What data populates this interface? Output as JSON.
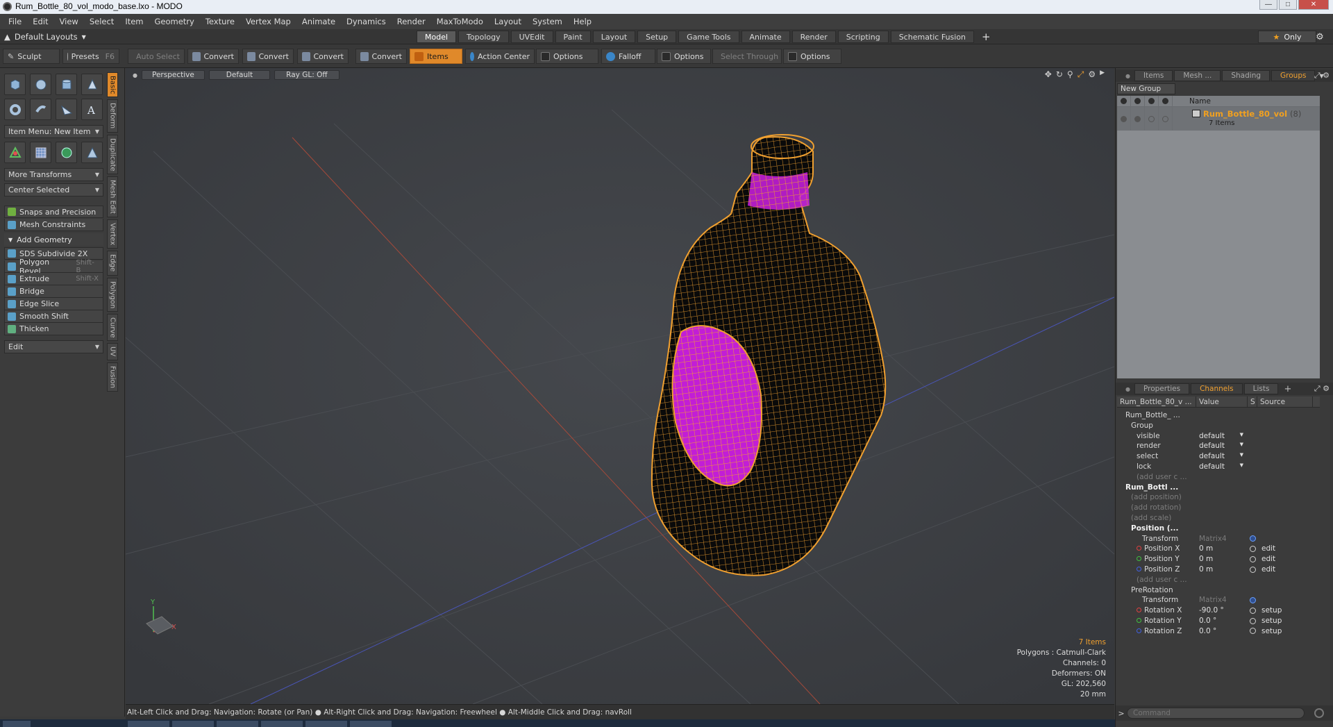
{
  "window": {
    "title": "Rum_Bottle_80_vol_modo_base.lxo - MODO"
  },
  "menubar": [
    "File",
    "Edit",
    "View",
    "Select",
    "Item",
    "Geometry",
    "Texture",
    "Vertex Map",
    "Animate",
    "Dynamics",
    "Render",
    "MaxToModo",
    "Layout",
    "System",
    "Help"
  ],
  "layoutbar": {
    "layout_label": "Default Layouts",
    "tabs": [
      "Model",
      "Topology",
      "UVEdit",
      "Paint",
      "Layout",
      "Setup",
      "Game Tools",
      "Animate",
      "Render",
      "Scripting",
      "Schematic Fusion"
    ],
    "active_tab": "Model",
    "only_label": "Only"
  },
  "toolbar": {
    "sculpt": "Sculpt",
    "presets": "Presets",
    "presets_key": "F6",
    "auto_select": "Auto Select",
    "convert": "Convert",
    "items": "Items",
    "action_center": "Action Center",
    "options": "Options",
    "falloff": "Falloff",
    "select_through": "Select Through"
  },
  "leftpanel": {
    "item_menu": "Item Menu: New Item",
    "more_transforms": "More Transforms",
    "center_selected": "Center Selected",
    "snaps": "Snaps and Precision",
    "mesh_constraints": "Mesh Constraints",
    "add_geometry": "Add Geometry",
    "tools": [
      {
        "label": "SDS Subdivide 2X",
        "key": ""
      },
      {
        "label": "Polygon Bevel",
        "key": "Shift-B"
      },
      {
        "label": "Extrude",
        "key": "Shift-X"
      },
      {
        "label": "Bridge",
        "key": ""
      },
      {
        "label": "Edge Slice",
        "key": ""
      },
      {
        "label": "Smooth Shift",
        "key": ""
      },
      {
        "label": "Thicken",
        "key": ""
      }
    ],
    "edit_menu": "Edit",
    "vertical_tabs": [
      "Basic",
      "Deform",
      "Duplicate",
      "Mesh Edit",
      "Vertex",
      "Edge",
      "Polygon",
      "Curve",
      "UV",
      "Fusion"
    ]
  },
  "viewport": {
    "view_mode": "Perspective",
    "shading": "Default",
    "raygl": "Ray GL: Off",
    "info": {
      "items": "7 Items",
      "polygons": "Polygons : Catmull-Clark",
      "channels": "Channels: 0",
      "deformers": "Deformers: ON",
      "gl": "GL: 202,560",
      "scale": "20 mm"
    },
    "axis_x": "X",
    "axis_y": "Y"
  },
  "statusbar": "Alt-Left Click and Drag: Navigation: Rotate (or Pan) ●  Alt-Right Click and Drag: Navigation: Freewheel ●  Alt-Middle Click and Drag: navRoll",
  "rightpanel": {
    "top_tabs": [
      "Items",
      "Mesh ...",
      "Shading",
      "Groups"
    ],
    "top_active": "Groups",
    "new_group": "New Group",
    "groups_header_name": "Name",
    "group": {
      "name": "Rum_Bottle_80_vol",
      "count": "(8)",
      "items": "7 Items"
    },
    "bottom_tabs": [
      "Properties",
      "Channels",
      "Lists"
    ],
    "bottom_active": "Channels",
    "channels_header": {
      "name": "Rum_Bottle_80_v ...",
      "value": "Value",
      "s": "S",
      "source": "Source"
    },
    "channels": [
      {
        "name": "Rum_Bottle_ ...",
        "indent": 1,
        "style": "",
        "value": "",
        "dd": false,
        "src": "",
        "ring": ""
      },
      {
        "name": "Group",
        "indent": 2,
        "style": "",
        "value": "",
        "dd": false,
        "src": "",
        "ring": ""
      },
      {
        "name": "visible",
        "indent": 3,
        "style": "",
        "value": "default",
        "dd": true,
        "src": "",
        "ring": ""
      },
      {
        "name": "render",
        "indent": 3,
        "style": "",
        "value": "default",
        "dd": true,
        "src": "",
        "ring": ""
      },
      {
        "name": "select",
        "indent": 3,
        "style": "",
        "value": "default",
        "dd": true,
        "src": "",
        "ring": ""
      },
      {
        "name": "lock",
        "indent": 3,
        "style": "",
        "value": "default",
        "dd": true,
        "src": "",
        "ring": ""
      },
      {
        "name": "(add user c ...",
        "indent": 3,
        "style": "dim",
        "value": "",
        "dd": false,
        "src": "",
        "ring": ""
      },
      {
        "name": "Rum_Bottl ...",
        "indent": 1,
        "style": "bold",
        "value": "",
        "dd": false,
        "src": "",
        "ring": ""
      },
      {
        "name": "(add position)",
        "indent": 2,
        "style": "dim",
        "value": "",
        "dd": false,
        "src": "",
        "ring": ""
      },
      {
        "name": "(add rotation)",
        "indent": 2,
        "style": "dim",
        "value": "",
        "dd": false,
        "src": "",
        "ring": ""
      },
      {
        "name": "(add scale)",
        "indent": 2,
        "style": "dim",
        "value": "",
        "dd": false,
        "src": "",
        "ring": ""
      },
      {
        "name": "Position (...",
        "indent": 2,
        "style": "bold",
        "value": "",
        "dd": false,
        "src": "",
        "ring": ""
      },
      {
        "name": "Transform",
        "indent": 4,
        "style": "",
        "value": "Matrix4",
        "valstyle": "dim",
        "dd": false,
        "src": "",
        "ring": "blue"
      },
      {
        "name": "Position X",
        "indent": 3,
        "style": "",
        "dot": "#e04040",
        "value": "0 m",
        "dd": false,
        "src": "edit",
        "ring": "plain"
      },
      {
        "name": "Position Y",
        "indent": 3,
        "style": "",
        "dot": "#40c040",
        "value": "0 m",
        "dd": false,
        "src": "edit",
        "ring": "plain"
      },
      {
        "name": "Position Z",
        "indent": 3,
        "style": "",
        "dot": "#4060e0",
        "value": "0 m",
        "dd": false,
        "src": "edit",
        "ring": "plain"
      },
      {
        "name": "(add user c ...",
        "indent": 3,
        "style": "dim",
        "value": "",
        "dd": false,
        "src": "",
        "ring": ""
      },
      {
        "name": "PreRotation",
        "indent": 2,
        "style": "",
        "value": "",
        "dd": false,
        "src": "",
        "ring": ""
      },
      {
        "name": "Transform",
        "indent": 4,
        "style": "",
        "value": "Matrix4",
        "valstyle": "dim",
        "dd": false,
        "src": "",
        "ring": "blue"
      },
      {
        "name": "Rotation X",
        "indent": 3,
        "style": "",
        "dot": "#e04040",
        "value": "-90.0 °",
        "dd": false,
        "src": "setup",
        "ring": "plain"
      },
      {
        "name": "Rotation Y",
        "indent": 3,
        "style": "",
        "dot": "#40c040",
        "value": "0.0 °",
        "dd": false,
        "src": "setup",
        "ring": "plain"
      },
      {
        "name": "Rotation Z",
        "indent": 3,
        "style": "",
        "dot": "#4060e0",
        "value": "0.0 °",
        "dd": false,
        "src": "setup",
        "ring": "plain"
      }
    ],
    "command_placeholder": "Command"
  }
}
